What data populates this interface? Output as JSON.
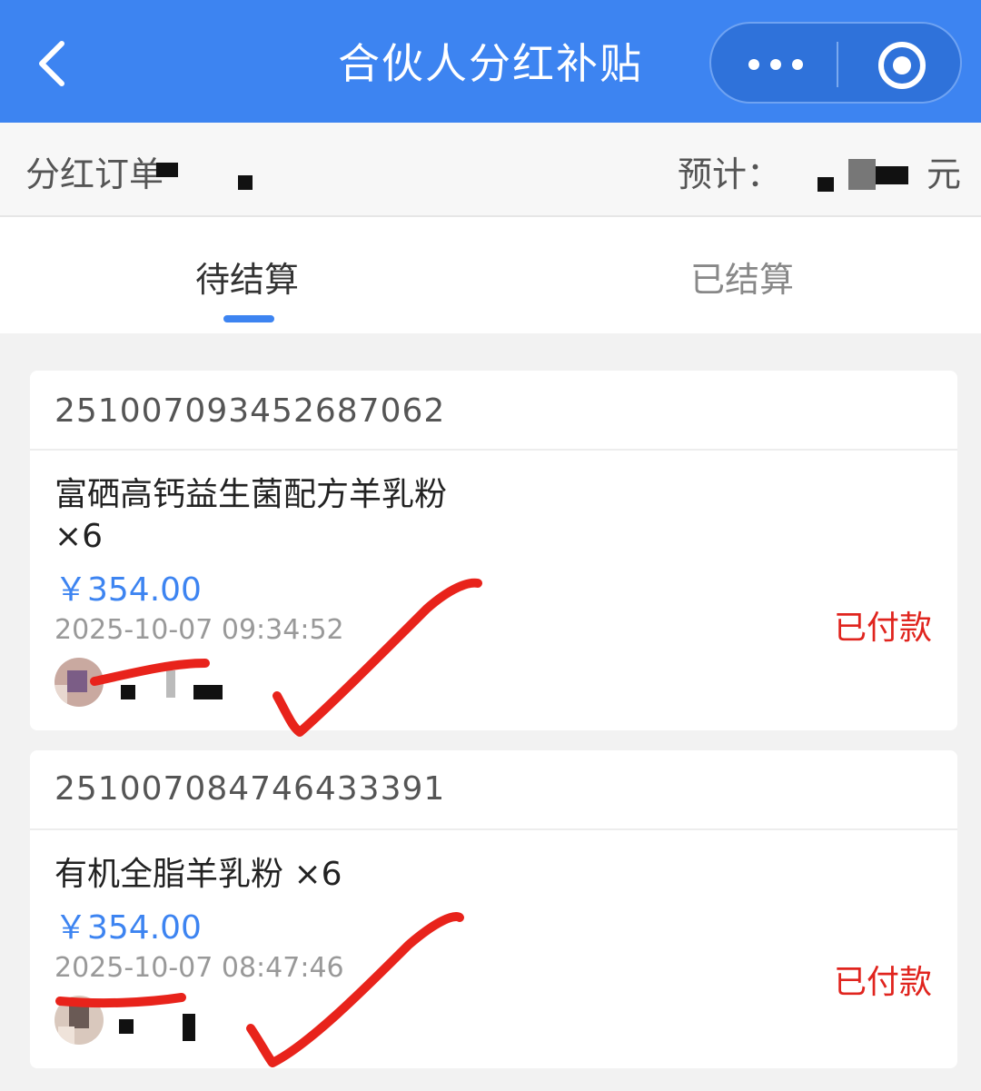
{
  "header": {
    "title": "合伙人分红补贴",
    "colors": {
      "brand": "#3d84f1",
      "capsule": "#2f72da"
    },
    "icons": [
      "back-icon",
      "more-icon",
      "target-icon"
    ]
  },
  "summary": {
    "left_label": "分红订单",
    "right_label": "预计：",
    "right_unit": "元"
  },
  "tabs": [
    {
      "label": "待结算",
      "active": true
    },
    {
      "label": "已结算",
      "active": false
    }
  ],
  "orders": [
    {
      "order_no": "251007093452687062",
      "product_line1": "富硒高钙益生菌配方羊乳粉",
      "product_line2": "×6",
      "price": "￥354.00",
      "time": "2025-10-07 09:34:52",
      "status": "已付款"
    },
    {
      "order_no": "251007084746433391",
      "product_line1": "有机全脂羊乳粉 ×6",
      "price": "￥354.00",
      "time": "2025-10-07 08:47:46",
      "status": "已付款"
    }
  ],
  "colors": {
    "status_red": "#e0241e",
    "annotation_red": "#e8231b"
  }
}
